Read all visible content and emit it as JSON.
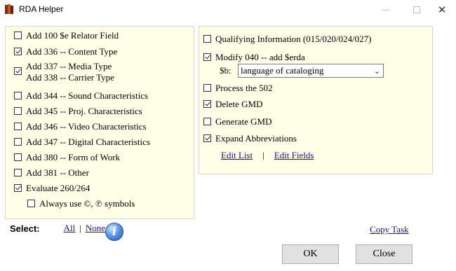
{
  "window": {
    "title": "RDA Helper",
    "minimize": "—",
    "maximize": "□",
    "close": "✕"
  },
  "left_options": [
    {
      "label": "Add 100 $e Relator Field",
      "checked": false
    },
    {
      "label": "Add 336 -- Content Type",
      "checked": true
    },
    {
      "label_line1": "Add 337 -- Media Type",
      "label_line2": "Add 338 -- Carrier Type",
      "checked": true
    },
    {
      "label": "Add 344 -- Sound Characteristics",
      "checked": false
    },
    {
      "label": "Add 345 -- Proj. Characteristics",
      "checked": false
    },
    {
      "label": "Add 346 -- Video Characteristics",
      "checked": false
    },
    {
      "label": "Add 347 -- Digital Characteristics",
      "checked": false
    },
    {
      "label": "Add 380 -- Form of Work",
      "checked": false
    },
    {
      "label": "Add 381 -- Other",
      "checked": false
    },
    {
      "label": "Evaluate 260/264",
      "checked": true
    },
    {
      "label": "Always use ©, ℗ symbols",
      "checked": false
    }
  ],
  "right_options": [
    {
      "label": "Qualifying Information (015/020/024/027)",
      "checked": false
    },
    {
      "label": "Modify 040 -- add $erda",
      "checked": true
    },
    {
      "label": "Process the 502",
      "checked": false
    },
    {
      "label": "Delete GMD",
      "checked": true
    },
    {
      "label": "Generate GMD",
      "checked": false
    },
    {
      "label": "Expand Abbreviations",
      "checked": true
    }
  ],
  "subfield_b": {
    "label": "$b:",
    "selected": "language of cataloging"
  },
  "right_links": {
    "edit_list": "Edit List",
    "separator": "|",
    "edit_fields": "Edit Fields"
  },
  "bottom": {
    "select_label": "Select:",
    "all": "All",
    "separator": "|",
    "none": "None",
    "info_icon": "info-icon",
    "copy_task": "Copy Task",
    "ok": "OK",
    "close": "Close"
  },
  "colors": {
    "panel_bg": "#ffffe8",
    "link": "#1a0dab",
    "button_bg": "#e1e1e1"
  }
}
